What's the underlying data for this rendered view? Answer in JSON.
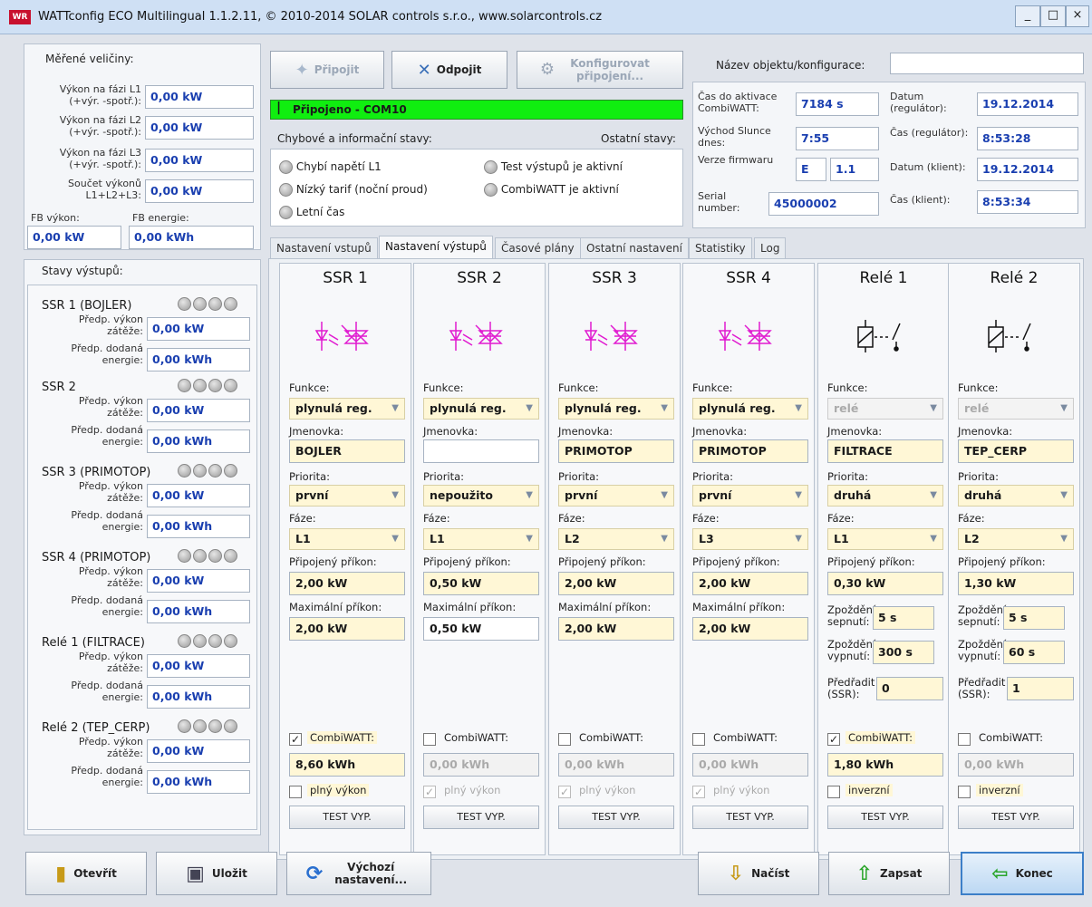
{
  "window": {
    "title": "WATTconfig ECO Multilingual 1.1.2.11, © 2010-2014 SOLAR controls s.r.o., www.solarcontrols.cz",
    "icon_text": "WR",
    "min": "_",
    "max": "□",
    "close": "×"
  },
  "measured": {
    "title": "Měřené veličiny:",
    "rows": [
      {
        "label1": "Výkon na fázi L1",
        "label2": "(+výr. -spotř.):",
        "value": "0,00 kW"
      },
      {
        "label1": "Výkon na fázi L2",
        "label2": "(+výr. -spotř.):",
        "value": "0,00 kW"
      },
      {
        "label1": "Výkon na fázi L3",
        "label2": "(+výr. -spotř.):",
        "value": "0,00 kW"
      },
      {
        "label1": "Součet výkonů",
        "label2": "L1+L2+L3:",
        "value": "0,00 kW"
      }
    ],
    "fb_power_label": "FB výkon:",
    "fb_energy_label": "FB energie:",
    "fb_power": "0,00 kW",
    "fb_energy": "0,00 kWh"
  },
  "outputs_state": {
    "title": "Stavy výstupů:",
    "power_label1": "Předp. výkon",
    "power_label2": "zátěže:",
    "energy_label1": "Předp. dodaná",
    "energy_label2": "energie:",
    "items": [
      {
        "name": "SSR 1 (BOJLER)",
        "power": "0,00 kW",
        "energy": "0,00 kWh"
      },
      {
        "name": "SSR 2",
        "power": "0,00 kW",
        "energy": "0,00 kWh"
      },
      {
        "name": "SSR 3 (PRIMOTOP)",
        "power": "0,00 kW",
        "energy": "0,00 kWh"
      },
      {
        "name": "SSR 4 (PRIMOTOP)",
        "power": "0,00 kW",
        "energy": "0,00 kWh"
      },
      {
        "name": "Relé 1 (FILTRACE)",
        "power": "0,00 kW",
        "energy": "0,00 kWh"
      },
      {
        "name": "Relé 2 (TEP_CERP)",
        "power": "0,00 kW",
        "energy": "0,00 kWh"
      }
    ]
  },
  "connection": {
    "connect": "Připojit",
    "disconnect": "Odpojit",
    "configure": "Konfigurovat připojení...",
    "status_mark": "|",
    "status": "Připojeno - COM10",
    "errors_title": "Chybové a informační stavy:",
    "other_title": "Ostatní stavy:",
    "flags": [
      "Chybí napětí L1",
      "Nízký tarif (noční proud)",
      "Letní čas"
    ],
    "other_flags": [
      "Test výstupů je aktivní",
      "CombiWATT je aktivní"
    ]
  },
  "info": {
    "object_name_label": "Název objektu/konfigurace:",
    "object_name": "",
    "activation_label": "Čas do aktivace CombiWATT:",
    "activation": "7184 s",
    "sunrise_label": "Východ Slunce dnes:",
    "sunrise": "7:55",
    "firmware_label": "Verze firmwaru",
    "firmware_a": "E",
    "firmware_b": "1.1",
    "serial_label": "Serial number:",
    "serial": "45000002",
    "date_reg_label": "Datum (regulátor):",
    "date_reg": "19.12.2014",
    "time_reg_label": "Čas (regulátor):",
    "time_reg": "8:53:28",
    "date_cli_label": "Datum (klient):",
    "date_cli": "19.12.2014",
    "time_cli_label": "Čas (klient):",
    "time_cli": "8:53:34"
  },
  "tabs": [
    "Nastavení vstupů",
    "Nastavení výstupů",
    "Časové plány",
    "Ostatní nastavení",
    "Statistiky",
    "Log"
  ],
  "labels": {
    "function": "Funkce:",
    "name": "Jmenovka:",
    "priority": "Priorita:",
    "phase": "Fáze:",
    "connected": "Připojený příkon:",
    "max": "Maximální příkon:",
    "delay_on": [
      "Zpoždění",
      "sepnutí:"
    ],
    "delay_off": [
      "Zpoždění",
      "vypnutí:"
    ],
    "preassign": [
      "Předřadit",
      "(SSR):"
    ],
    "combiwatt": "CombiWATT:",
    "full": "plný výkon",
    "inverse": "inverzní",
    "test": "TEST VYP."
  },
  "columns": [
    {
      "title": "SSR 1",
      "function": "plynulá reg.",
      "name": "BOJLER",
      "priority": "první",
      "phase": "L1",
      "connected": "2,00 kW",
      "max": "2,00 kW",
      "combi_checked": true,
      "combi_value": "8,60 kWh",
      "full_checked": false,
      "type": "ssr"
    },
    {
      "title": "SSR 2",
      "function": "plynulá reg.",
      "name": "",
      "priority": "nepoužito",
      "phase": "L1",
      "connected": "0,50 kW",
      "max": "0,50 kW",
      "combi_checked": false,
      "combi_value": "0,00 kWh",
      "full_checked": true,
      "type": "ssr"
    },
    {
      "title": "SSR 3",
      "function": "plynulá reg.",
      "name": "PRIMOTOP",
      "priority": "první",
      "phase": "L2",
      "connected": "2,00 kW",
      "max": "2,00 kW",
      "combi_checked": false,
      "combi_value": "0,00 kWh",
      "full_checked": true,
      "type": "ssr"
    },
    {
      "title": "SSR 4",
      "function": "plynulá reg.",
      "name": "PRIMOTOP",
      "priority": "první",
      "phase": "L3",
      "connected": "2,00 kW",
      "max": "2,00 kW",
      "combi_checked": false,
      "combi_value": "0,00 kWh",
      "full_checked": true,
      "type": "ssr"
    },
    {
      "title": "Relé 1",
      "function": "relé",
      "name": "FILTRACE",
      "priority": "druhá",
      "phase": "L1",
      "connected": "0,30 kW",
      "delay_on": "5 s",
      "delay_off": "300 s",
      "preassign": "0",
      "combi_checked": true,
      "combi_value": "1,80 kWh",
      "inv_checked": false,
      "type": "relay"
    },
    {
      "title": "Relé 2",
      "function": "relé",
      "name": "TEP_CERP",
      "priority": "druhá",
      "phase": "L2",
      "connected": "1,30 kW",
      "delay_on": "5 s",
      "delay_off": "60 s",
      "preassign": "1",
      "combi_checked": false,
      "combi_value": "0,00 kWh",
      "inv_checked": false,
      "type": "relay"
    }
  ],
  "bottom": {
    "open": "Otevřít",
    "save": "Uložit",
    "defaults": "Výchozí nastavení...",
    "load": "Načíst",
    "write": "Zapsat",
    "exit": "Konec"
  }
}
